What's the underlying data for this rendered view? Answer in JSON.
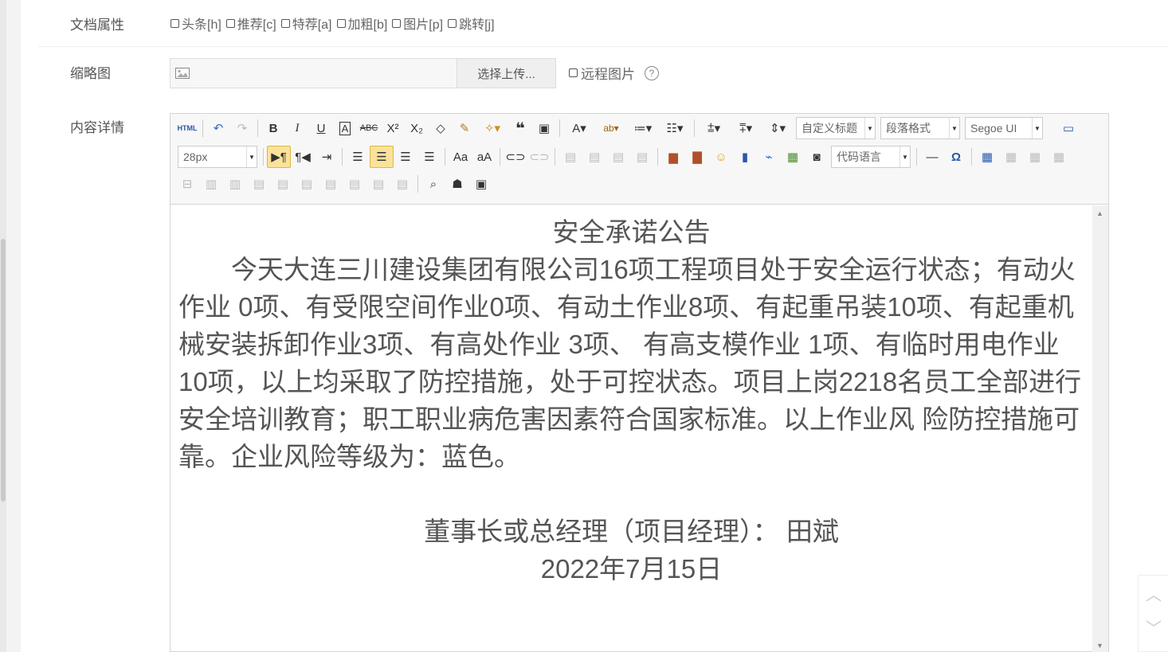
{
  "form": {
    "attrs_label": "文档属性",
    "attrs_options": [
      {
        "label": "头条[h]",
        "checked": false
      },
      {
        "label": "推荐[c]",
        "checked": false
      },
      {
        "label": "特荐[a]",
        "checked": false
      },
      {
        "label": "加粗[b]",
        "checked": false
      },
      {
        "label": "图片[p]",
        "checked": false
      },
      {
        "label": "跳转[j]",
        "checked": false
      }
    ],
    "thumb_label": "缩略图",
    "thumb_value": "",
    "upload_button": "选择上传...",
    "remote_image_label": "远程图片",
    "content_label": "内容详情"
  },
  "editor": {
    "toolbar": {
      "html_label": "HTML",
      "custom_heading": "自定义标题",
      "paragraph_format": "段落格式",
      "font_family": "Segoe UI",
      "font_size": "28px",
      "code_language": "代码语言"
    },
    "body": {
      "title": "安全承诺公告",
      "paragraph": "今天大连三川建设集团有限公司16项工程项目处于安全运行状态；有动火作业 0项、有受限空间作业0项、有动土作业8项、有起重吊装10项、有起重机械安装拆卸作业3项、有高处作业 3项、 有高支模作业 1项、有临时用电作业 10项，以上均采取了防控措施，处于可控状态。项目上岗2218名员工全部进行安全培训教育；职工职业病危害因素符合国家标准。以上作业风 险防控措施可靠。企业风险等级为：蓝色。",
      "signer": "董事长或总经理（项目经理）： 田斌",
      "date": "2022年7月15日"
    }
  },
  "colors": {
    "active_button": "#fbe29a",
    "border": "#d4d4d4",
    "text": "#555555"
  }
}
